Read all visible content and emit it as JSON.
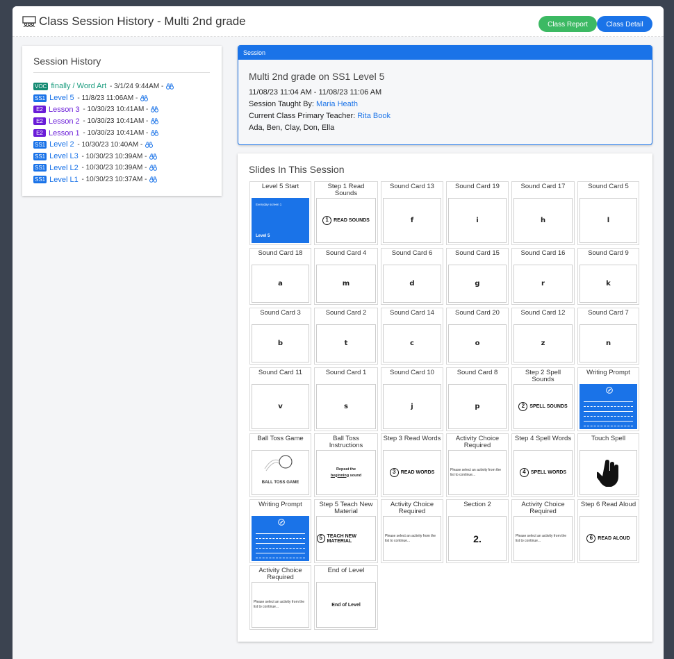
{
  "header": {
    "title": "Class Session History - Multi 2nd grade",
    "class_report_label": "Class Report",
    "class_detail_label": "Class Detail"
  },
  "history": {
    "title": "Session History",
    "items": [
      {
        "tag": "VOC",
        "kind": "voc",
        "name": "finally / Word Art",
        "date": "3/1/24 9:44AM"
      },
      {
        "tag": "SS1",
        "kind": "ss1",
        "name": "Level 5",
        "date": "11/8/23 11:06AM"
      },
      {
        "tag": "E2",
        "kind": "e2",
        "name": "Lesson 3",
        "date": "10/30/23 10:41AM"
      },
      {
        "tag": "E2",
        "kind": "e2",
        "name": "Lesson 2",
        "date": "10/30/23 10:41AM"
      },
      {
        "tag": "E2",
        "kind": "e2",
        "name": "Lesson 1",
        "date": "10/30/23 10:41AM"
      },
      {
        "tag": "SS1",
        "kind": "ss1",
        "name": "Level 2",
        "date": "10/30/23 10:40AM"
      },
      {
        "tag": "SS1",
        "kind": "ss1",
        "name": "Level L3",
        "date": "10/30/23 10:39AM"
      },
      {
        "tag": "SS1",
        "kind": "ss1",
        "name": "Level L2",
        "date": "10/30/23 10:39AM"
      },
      {
        "tag": "SS1",
        "kind": "ss1",
        "name": "Level L1",
        "date": "10/30/23 10:37AM"
      }
    ]
  },
  "session": {
    "header": "Session",
    "title": "Multi 2nd grade on SS1 Level 5",
    "time_range": "11/08/23 11:04 AM - 11/08/23 11:06 AM",
    "taught_by_label": "Session Taught By:",
    "taught_by": "Maria Heath",
    "teacher_label": "Current Class Primary Teacher:",
    "teacher": "Rita Book",
    "students": "Ada, Ben, Clay, Don, Ella"
  },
  "slides": {
    "title": "Slides In This Session",
    "rows": [
      [
        {
          "title": "Level 5 Start",
          "kind": "start",
          "small": "Everyday screen 1",
          "text": "Level 5"
        },
        {
          "title": "Step 1 Read Sounds",
          "kind": "step",
          "num": "1",
          "text": "READ SOUNDS"
        },
        {
          "title": "Sound Card 13",
          "kind": "letter",
          "text": "f"
        },
        {
          "title": "Sound Card 19",
          "kind": "letter",
          "text": "i"
        },
        {
          "title": "Sound Card 17",
          "kind": "letter",
          "text": "h"
        },
        {
          "title": "Sound Card 5",
          "kind": "letter",
          "text": "l"
        }
      ],
      [
        {
          "title": "Sound Card 18",
          "kind": "letter",
          "text": "a"
        },
        {
          "title": "Sound Card 4",
          "kind": "letter",
          "text": "m"
        },
        {
          "title": "Sound Card 6",
          "kind": "letter",
          "text": "d"
        },
        {
          "title": "Sound Card 15",
          "kind": "letter",
          "text": "g"
        },
        {
          "title": "Sound Card 16",
          "kind": "letter",
          "text": "r"
        },
        {
          "title": "Sound Card 9",
          "kind": "letter",
          "text": "k"
        }
      ],
      [
        {
          "title": "Sound Card 3",
          "kind": "letter",
          "text": "b"
        },
        {
          "title": "Sound Card 2",
          "kind": "letter",
          "text": "t"
        },
        {
          "title": "Sound Card 14",
          "kind": "letter",
          "text": "c"
        },
        {
          "title": "Sound Card 20",
          "kind": "letter",
          "text": "o"
        },
        {
          "title": "Sound Card 12",
          "kind": "letter",
          "text": "z"
        },
        {
          "title": "Sound Card 7",
          "kind": "letter",
          "text": "n"
        }
      ],
      [
        {
          "title": "Sound Card 11",
          "kind": "letter",
          "text": "v"
        },
        {
          "title": "Sound Card 1",
          "kind": "letter",
          "text": "s"
        },
        {
          "title": "Sound Card 10",
          "kind": "letter",
          "text": "j"
        },
        {
          "title": "Sound Card 8",
          "kind": "letter",
          "text": "p"
        },
        {
          "title": "Step 2 Spell Sounds",
          "kind": "step",
          "num": "2",
          "text": "SPELL SOUNDS"
        },
        {
          "title": "Writing Prompt",
          "kind": "writing"
        }
      ],
      [
        {
          "title": "Ball Toss Game",
          "kind": "balltoss",
          "text": "BALL TOSS GAME"
        },
        {
          "title": "Ball Toss Instructions",
          "kind": "instructions",
          "text": "Repeat the",
          "text2": "beginning",
          "text3": "sound"
        },
        {
          "title": "Step 3 Read Words",
          "kind": "step",
          "num": "3",
          "text": "READ WORDS"
        },
        {
          "title": "Activity Choice Required",
          "kind": "choice",
          "text": "Please select an activity from the list to continue..."
        },
        {
          "title": "Step 4 Spell Words",
          "kind": "step",
          "num": "4",
          "text": "SPELL WORDS"
        },
        {
          "title": "Touch Spell",
          "kind": "hand"
        }
      ],
      [
        {
          "title": "Writing Prompt",
          "kind": "writing"
        },
        {
          "title": "Step 5 Teach New Material",
          "kind": "step",
          "num": "5",
          "text": "TEACH NEW MATERIAL"
        },
        {
          "title": "Activity Choice Required",
          "kind": "choice",
          "text": "Please select an activity from the list to continue..."
        },
        {
          "title": "Section 2",
          "kind": "section",
          "text": "2."
        },
        {
          "title": "Activity Choice Required",
          "kind": "choice",
          "text": "Please select an activity from the list to continue..."
        },
        {
          "title": "Step 6 Read Aloud",
          "kind": "step",
          "num": "6",
          "text": "READ ALOUD"
        }
      ],
      [
        {
          "title": "Activity Choice Required",
          "kind": "choice",
          "text": "Please select an activity from the list to continue..."
        },
        {
          "title": "End of Level",
          "kind": "end",
          "text": "End of Level"
        }
      ]
    ]
  },
  "colors": {
    "voc": "#138a72",
    "ss1": "#1a73e8",
    "e2": "#6a1cd8",
    "report": "#3cb963",
    "detail": "#1a73e8"
  }
}
